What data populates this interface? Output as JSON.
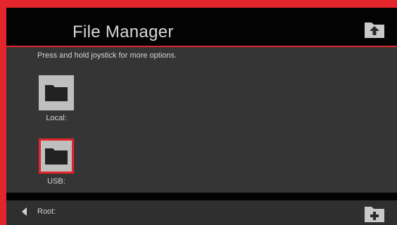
{
  "window": {
    "title": "File Manager",
    "accent_color": "#e4262c",
    "up_button_icon": "folder-up-icon"
  },
  "hint": "Press and hold joystick for more options.",
  "items": [
    {
      "label": "Local:",
      "icon": "folder-icon",
      "selected": false
    },
    {
      "label": "USB:",
      "icon": "folder-icon",
      "selected": true
    }
  ],
  "footer": {
    "back_icon": "arrow-left-icon",
    "path_label": "Root:",
    "new_folder_icon": "folder-add-icon"
  }
}
